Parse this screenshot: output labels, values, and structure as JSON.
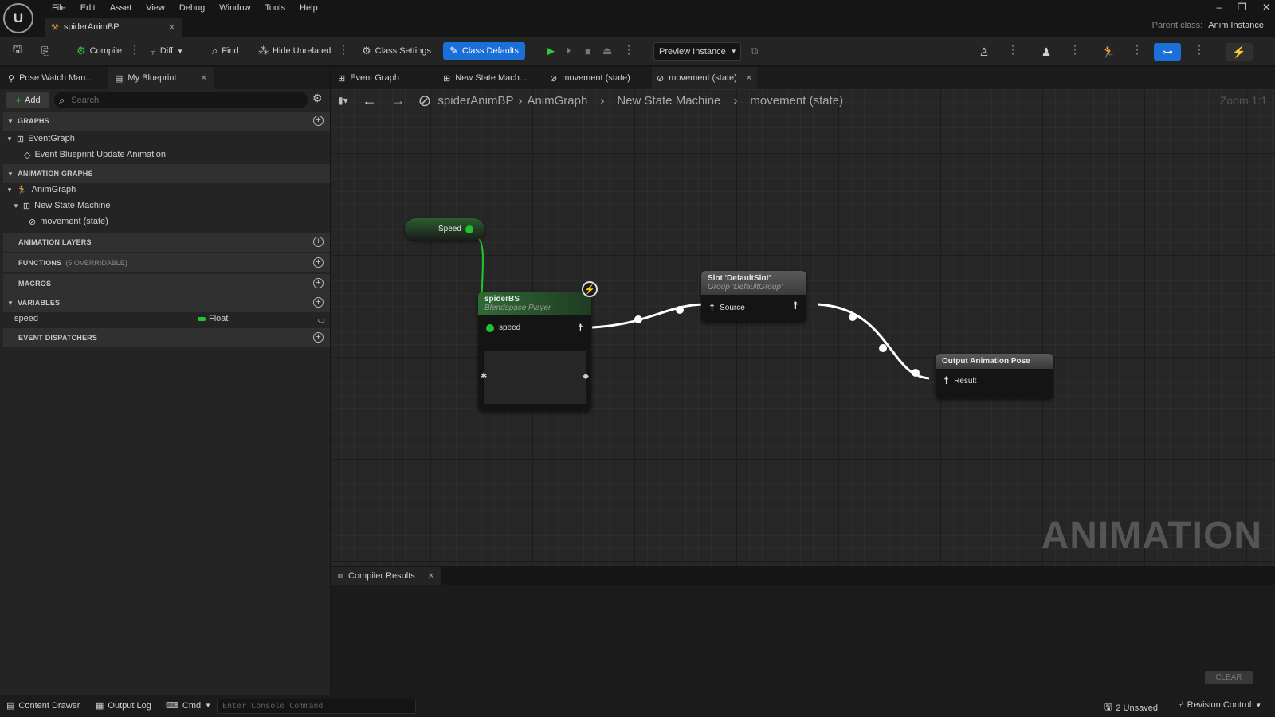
{
  "menu": [
    "File",
    "Edit",
    "Asset",
    "View",
    "Debug",
    "Window",
    "Tools",
    "Help"
  ],
  "doc_tab": {
    "title": "spiderAnimBP"
  },
  "parent_class": {
    "label": "Parent class:",
    "value": "Anim Instance"
  },
  "toolbar": {
    "compile": "Compile",
    "diff": "Diff",
    "find": "Find",
    "hide_unrelated": "Hide Unrelated",
    "class_settings": "Class Settings",
    "class_defaults": "Class Defaults",
    "preview_instance": "Preview Instance"
  },
  "left_tabs": [
    "Pose Watch Man...",
    "My Blueprint"
  ],
  "left_panel": {
    "add": "Add",
    "search_placeholder": "Search",
    "graphs_header": "GRAPHS",
    "event_graph": "EventGraph",
    "event_update": "Event Blueprint Update Animation",
    "anim_graphs_header": "ANIMATION GRAPHS",
    "anim_graph": "AnimGraph",
    "state_machine": "New State Machine",
    "state": "movement (state)",
    "anim_layers_header": "ANIMATION LAYERS",
    "functions_header": "FUNCTIONS",
    "functions_note": "(5 OVERRIDABLE)",
    "macros_header": "MACROS",
    "variables_header": "VARIABLES",
    "var_name": "speed",
    "var_type": "Float",
    "dispatchers_header": "EVENT DISPATCHERS"
  },
  "graph_tabs": [
    "Event Graph",
    "New State Mach...",
    "movement (state)",
    "movement (state)"
  ],
  "breadcrumb": [
    "spiderAnimBP",
    "AnimGraph",
    "New State Machine",
    "movement (state)"
  ],
  "zoom": "Zoom 1:1",
  "watermark": "ANIMATION",
  "nodes": {
    "speed_getter": "Speed",
    "blendspace": {
      "title": "spiderBS",
      "subtitle": "Blendspace Player",
      "pin": "speed"
    },
    "slot": {
      "title": "Slot 'DefaultSlot'",
      "subtitle": "Group 'DefaultGroup'",
      "pin": "Source"
    },
    "output": {
      "title": "Output Animation Pose",
      "pin": "Result"
    }
  },
  "compiler": {
    "tab": "Compiler Results",
    "clear": "CLEAR"
  },
  "statusbar": {
    "content_drawer": "Content Drawer",
    "output_log": "Output Log",
    "cmd": "Cmd",
    "console_placeholder": "Enter Console Command",
    "unsaved": "2 Unsaved",
    "revision": "Revision Control"
  },
  "colors": {
    "accent": "#1b6fd9",
    "pin_green": "#22c12f",
    "blendspace_header": "#2e6b34",
    "slot_header": "#4a4a4a"
  }
}
